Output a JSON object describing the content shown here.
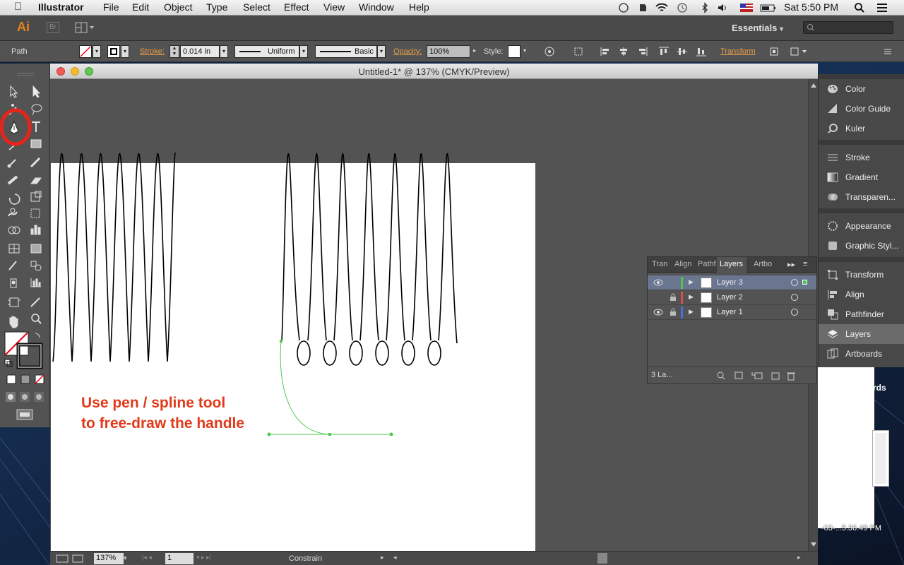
{
  "menubar": {
    "apple": "",
    "app": "Illustrator",
    "items": [
      "File",
      "Edit",
      "Object",
      "Type",
      "Select",
      "Effect",
      "View",
      "Window",
      "Help"
    ],
    "clock": "Sat 5:50 PM"
  },
  "appbar": {
    "logo": "Ai",
    "bridge": "Br",
    "workspace": "Essentials",
    "workspace_caret": "▾"
  },
  "control": {
    "selection_type": "Path",
    "stroke_label": "Stroke:",
    "stroke_weight": "0.014 in",
    "profile": "Uniform",
    "brush": "Basic",
    "opacity_label": "Opacity:",
    "opacity_value": "100%",
    "style_label": "Style:",
    "transform_label": "Transform"
  },
  "document": {
    "title": "Untitled-1* @ 137% (CMYK/Preview)",
    "zoom": "137%",
    "artboard_number": "1",
    "status_tool": "Constrain"
  },
  "annotation": {
    "line1": "Use pen / spline tool",
    "line2": "to free-draw the handle"
  },
  "layers_panel": {
    "tabs": [
      "Tran",
      "Align",
      "Pathf",
      "Layers",
      "Artbo"
    ],
    "active_tab": "Layers",
    "layers": [
      {
        "name": "Layer 3",
        "color": "#4ec94e",
        "visible": true,
        "locked": false,
        "selected": true
      },
      {
        "name": "Layer 2",
        "color": "#e04b4b",
        "visible": false,
        "locked": true,
        "selected": false
      },
      {
        "name": "Layer 1",
        "color": "#4b6fe0",
        "visible": true,
        "locked": true,
        "selected": false
      }
    ],
    "count_label": "3 La..."
  },
  "dock": {
    "items": [
      {
        "label": "Color",
        "icon": "palette-icon"
      },
      {
        "label": "Color Guide",
        "icon": "color-guide-icon"
      },
      {
        "label": "Kuler",
        "icon": "kuler-icon"
      },
      {
        "label": "Stroke",
        "icon": "stroke-icon"
      },
      {
        "label": "Gradient",
        "icon": "gradient-icon"
      },
      {
        "label": "Transparen...",
        "icon": "transparency-icon"
      },
      {
        "label": "Appearance",
        "icon": "appearance-icon"
      },
      {
        "label": "Graphic Styl...",
        "icon": "graphic-styles-icon"
      },
      {
        "label": "Transform",
        "icon": "transform-icon"
      },
      {
        "label": "Align",
        "icon": "align-icon"
      },
      {
        "label": "Pathfinder",
        "icon": "pathfinder-icon"
      },
      {
        "label": "Layers",
        "icon": "layers-icon"
      },
      {
        "label": "Artboards",
        "icon": "artboards-icon"
      }
    ],
    "selected": "Layers"
  },
  "behind_window": {
    "partial_title": "rds",
    "partial_filename": "-03-...5.36.49 PM"
  },
  "colors": {
    "accent_orange": "#e8821d",
    "annotation_red": "#e03a1a",
    "selection_green": "#4ec94e",
    "highlight_circle": "#e8241a"
  }
}
